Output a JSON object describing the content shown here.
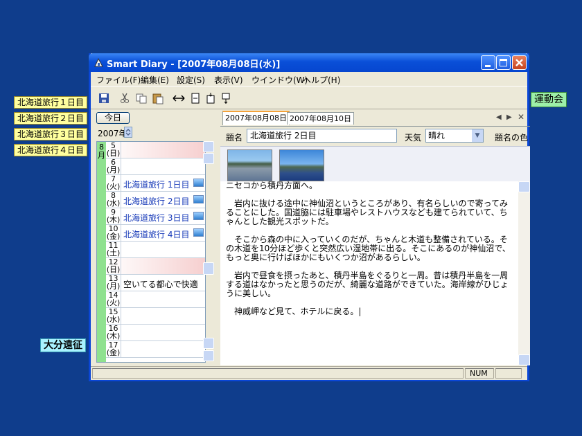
{
  "desktop": {
    "notes": [
      {
        "label": "北海道旅行１日目"
      },
      {
        "label": "北海道旅行２日目"
      },
      {
        "label": "北海道旅行３日目"
      },
      {
        "label": "北海道旅行４日目"
      }
    ],
    "green_note": "運動会",
    "cyan_note": "大分遠征"
  },
  "window": {
    "title": "Smart Diary - [2007年08月08日(水)]",
    "menu": [
      "ファイル(F)",
      "編集(E)",
      "設定(S)",
      "表示(V)",
      "ウインドウ(W)",
      "ヘルプ(H)"
    ],
    "toolbar_icons": [
      "save-icon",
      "cut-icon",
      "copy-icon",
      "paste-icon",
      "width-icon",
      "insert-above-icon",
      "insert-below-icon",
      "insert-after-icon"
    ]
  },
  "calendar": {
    "today_button": "今日",
    "year": "2007年",
    "month": "8月",
    "days": [
      {
        "num": "5",
        "dow": "(日)",
        "title": "",
        "weekend": true,
        "img": false
      },
      {
        "num": "6",
        "dow": "(月)",
        "title": "",
        "weekend": false,
        "img": false
      },
      {
        "num": "7",
        "dow": "(火)",
        "title": "北海道旅行 1日目",
        "weekend": false,
        "img": true
      },
      {
        "num": "8",
        "dow": "(水)",
        "title": "北海道旅行 2日目",
        "weekend": false,
        "img": true
      },
      {
        "num": "9",
        "dow": "(木)",
        "title": "北海道旅行 3日目",
        "weekend": false,
        "img": true
      },
      {
        "num": "10",
        "dow": "(金)",
        "title": "北海道旅行 4日目",
        "weekend": false,
        "img": true
      },
      {
        "num": "11",
        "dow": "(土)",
        "title": "",
        "weekend": false,
        "img": false
      },
      {
        "num": "12",
        "dow": "(日)",
        "title": "",
        "weekend": true,
        "img": false
      },
      {
        "num": "13",
        "dow": "(月)",
        "title": "空いてる都心で快適",
        "weekend": false,
        "img": false
      },
      {
        "num": "14",
        "dow": "(火)",
        "title": "",
        "weekend": false,
        "img": false
      },
      {
        "num": "15",
        "dow": "(水)",
        "title": "",
        "weekend": false,
        "img": false
      },
      {
        "num": "16",
        "dow": "(木)",
        "title": "",
        "weekend": false,
        "img": false
      },
      {
        "num": "17",
        "dow": "(金)",
        "title": "",
        "weekend": false,
        "img": false
      }
    ]
  },
  "editor": {
    "tabs": [
      "2007年08月08日",
      "2007年08月10日"
    ],
    "title_label": "題名",
    "title_value": "北海道旅行 2日目",
    "weather_label": "天気",
    "weather_value": "晴れ",
    "title_color_label": "題名の色",
    "paragraphs": [
      "ニセコから積丹方面へ。",
      "　岩内に抜ける途中に神仙沼というところがあり、有名らしいので寄ってみることにした。国道脇には駐車場やレストハウスなども建てられていて、ちゃんとした観光スポットだ。",
      "　そこから森の中に入っていくのだが、ちゃんと木道も整備されている。その木道を10分ほど歩くと突然広い湿地帯に出る。そこにあるのが神仙沼で、もっと奥に行けばほかにもいくつか沼があるらしい。",
      "　岩内で昼食を摂ったあと、積丹半島をぐるりと一周。昔は積丹半島を一周する道はなかったと思うのだが、綺麗な道路ができていた。海岸線がひじょうに美しい。",
      "　神威岬など見て、ホテルに戻る。|"
    ]
  },
  "status": {
    "num": "NUM"
  }
}
